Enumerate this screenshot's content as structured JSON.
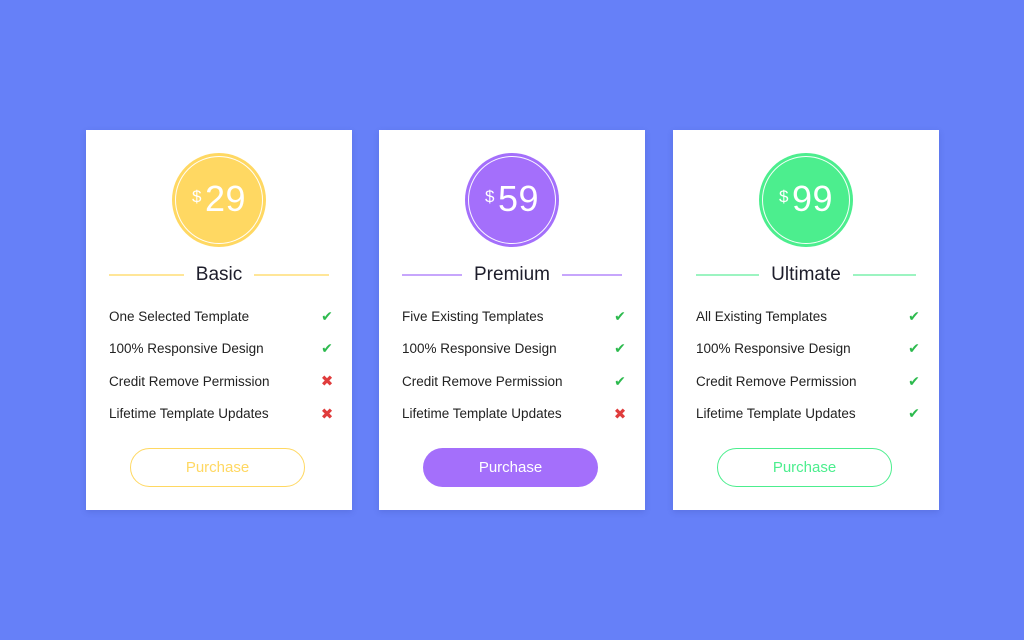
{
  "plans": [
    {
      "name": "Basic",
      "currency": "$",
      "price": "29",
      "accent": "#ffd862",
      "line_color": "#ffe698",
      "features": [
        {
          "label": "One Selected Template",
          "included": true
        },
        {
          "label": "100% Responsive Design",
          "included": true
        },
        {
          "label": "Credit Remove Permission",
          "included": false
        },
        {
          "label": "Lifetime Template Updates",
          "included": false
        }
      ],
      "button_label": "Purchase",
      "button_style": "outline"
    },
    {
      "name": "Premium",
      "currency": "$",
      "price": "59",
      "accent": "#a46ffb",
      "line_color": "#c7a6fc",
      "features": [
        {
          "label": "Five Existing Templates",
          "included": true
        },
        {
          "label": "100% Responsive Design",
          "included": true
        },
        {
          "label": "Credit Remove Permission",
          "included": true
        },
        {
          "label": "Lifetime Template Updates",
          "included": false
        }
      ],
      "button_label": "Purchase",
      "button_style": "filled"
    },
    {
      "name": "Ultimate",
      "currency": "$",
      "price": "99",
      "accent": "#4cee8e",
      "line_color": "#9cf4c1",
      "features": [
        {
          "label": "All Existing Templates",
          "included": true
        },
        {
          "label": "100% Responsive Design",
          "included": true
        },
        {
          "label": "Credit Remove Permission",
          "included": true
        },
        {
          "label": "Lifetime Template Updates",
          "included": true
        }
      ],
      "button_label": "Purchase",
      "button_style": "outline"
    }
  ],
  "icons": {
    "included": "check-icon",
    "excluded": "cross-icon"
  },
  "colors": {
    "background": "#6680f8",
    "check": "#2dba4e",
    "cross": "#e03c3c"
  }
}
